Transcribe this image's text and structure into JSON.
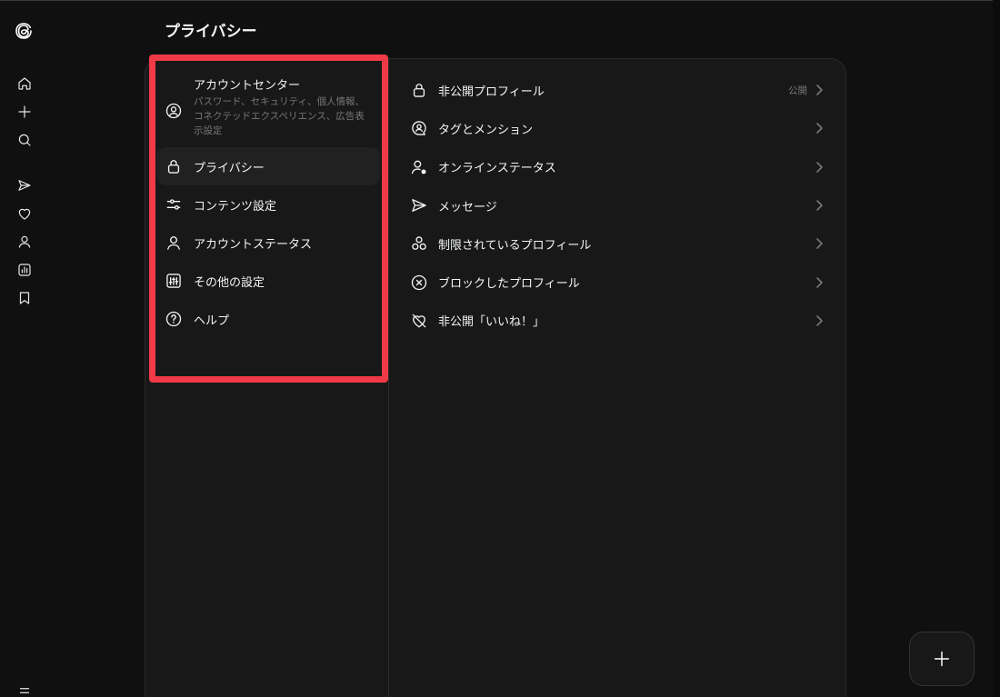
{
  "page": {
    "title": "プライバシー"
  },
  "rail": {
    "items": [
      {
        "name": "home-icon"
      },
      {
        "name": "plus-icon"
      },
      {
        "name": "search-icon"
      },
      {
        "name": "send-icon"
      },
      {
        "name": "heart-icon"
      },
      {
        "name": "person-icon"
      },
      {
        "name": "insights-icon"
      },
      {
        "name": "bookmark-icon"
      },
      {
        "name": "menu-icon"
      }
    ]
  },
  "settings_nav": {
    "account_center": {
      "title": "アカウントセンター",
      "subtitle": "パスワード、セキュリティ、個人情報、コネクテッドエクスペリエンス、広告表示設定"
    },
    "items": [
      {
        "label": "プライバシー",
        "icon": "lock-icon",
        "active": true
      },
      {
        "label": "コンテンツ設定",
        "icon": "sliders-icon",
        "active": false
      },
      {
        "label": "アカウントステータス",
        "icon": "person-icon",
        "active": false
      },
      {
        "label": "その他の設定",
        "icon": "settings-box-icon",
        "active": false
      },
      {
        "label": "ヘルプ",
        "icon": "help-icon",
        "active": false
      }
    ]
  },
  "privacy_list": {
    "items": [
      {
        "label": "非公開プロフィール",
        "value": "公開",
        "icon": "lock-icon"
      },
      {
        "label": "タグとメンション",
        "value": "",
        "icon": "mention-icon"
      },
      {
        "label": "オンラインステータス",
        "value": "",
        "icon": "online-status-icon"
      },
      {
        "label": "メッセージ",
        "value": "",
        "icon": "send-icon"
      },
      {
        "label": "制限されているプロフィール",
        "value": "",
        "icon": "restricted-icon"
      },
      {
        "label": "ブロックしたプロフィール",
        "value": "",
        "icon": "block-icon"
      },
      {
        "label": "非公開「いいね！」",
        "value": "",
        "icon": "hidden-like-icon"
      }
    ]
  },
  "colors": {
    "background": "#101010",
    "panel": "#181818",
    "highlight": "#f03a47",
    "text": "#f3f5f7",
    "muted": "#777777"
  }
}
